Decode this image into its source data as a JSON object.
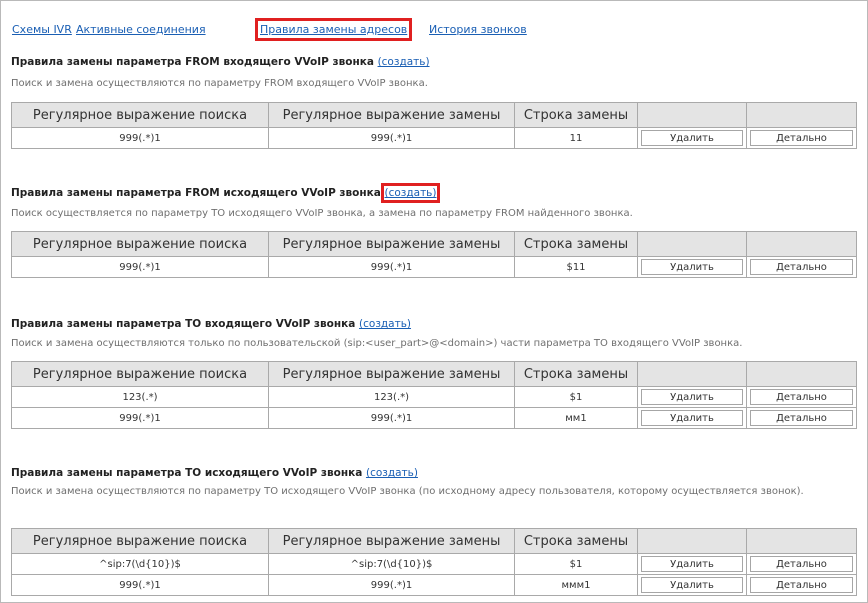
{
  "tabs": [
    {
      "label": "Схемы IVR"
    },
    {
      "label": "Активные соединения"
    },
    {
      "label": "Правила замены адресов"
    },
    {
      "label": "История звонков"
    }
  ],
  "columns": [
    "Регулярное выражение поиска",
    "Регулярное выражение замены",
    "Строка замены"
  ],
  "buttons": {
    "delete": "Удалить",
    "details": "Детально"
  },
  "sections": [
    {
      "title": "Правила замены параметра FROM входящего VVoIP звонка",
      "create": "(создать)",
      "description": "Поиск и замена осуществляются по параметру FROM входящего VVoIP звонка.",
      "rows": [
        {
          "search": "999(.*)1",
          "replace": "999(.*)1",
          "string": "11"
        }
      ]
    },
    {
      "title": "Правила замены параметра FROM исходящего VVoIP звонка",
      "create": "(создать)",
      "description": "Поиск осуществляется по параметру TO исходящего VVoIP звонка, а замена по параметру FROM найденного звонка.",
      "rows": [
        {
          "search": "999(.*)1",
          "replace": "999(.*)1",
          "string": "$11"
        }
      ]
    },
    {
      "title": "Правила замены параметра TO входящего VVoIP звонка",
      "create": "(создать)",
      "description": "Поиск и замена осуществляются только по пользовательской (sip:<user_part>@<domain>) части параметра TO входящего VVoIP звонка.",
      "rows": [
        {
          "search": "123(.*)",
          "replace": "123(.*)",
          "string": "$1"
        },
        {
          "search": "999(.*)1",
          "replace": "999(.*)1",
          "string": "мм1"
        }
      ]
    },
    {
      "title": "Правила замены параметра TO исходящего VVoIP звонка",
      "create": "(создать)",
      "description": "Поиск и замена осуществляются по параметру TO исходящего VVoIP звонка (по исходному адресу пользователя, которому осуществляется звонок).",
      "rows": [
        {
          "search": "^sip:7(\\d{10})$",
          "replace": "^sip:7(\\d{10})$",
          "string": "$1"
        },
        {
          "search": "999(.*)1",
          "replace": "999(.*)1",
          "string": "ммм1"
        }
      ]
    }
  ],
  "highlight_color": "#e02020",
  "link_color": "#1a5fb4"
}
